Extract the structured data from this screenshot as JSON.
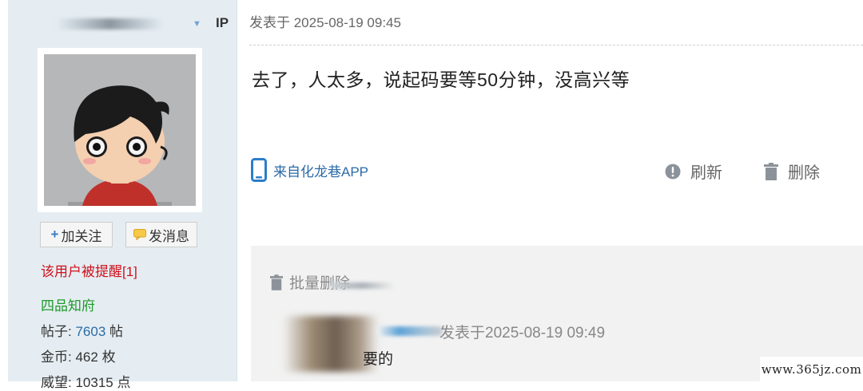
{
  "sidebar": {
    "ip_label": "IP",
    "follow_button": "加关注",
    "message_button": "发消息",
    "warning": "该用户被提醒[1]",
    "rank": "四品知府",
    "posts_label": "帖子:",
    "posts_value": "7603",
    "posts_unit": "帖",
    "coins_label": "金币:",
    "coins_value": "462",
    "coins_unit": "枚",
    "prestige_label": "威望:",
    "prestige_value": "10315",
    "prestige_unit": "点"
  },
  "post": {
    "time": "发表于 2025-08-19 09:45",
    "body": "去了，人太多，说起码要等50分钟，没高兴等",
    "source": "来自化龙巷APP",
    "refresh": "刷新",
    "delete": "删除"
  },
  "comments": {
    "batch_delete": "批量删除",
    "items": [
      {
        "time": "发表于2025-08-19 09:49",
        "text": "要的"
      }
    ]
  },
  "watermark": "www.365jz.com",
  "colors": {
    "sidebar_bg": "#e5edf2",
    "link_blue": "#2b6aa8",
    "warning_red": "#d0101b",
    "rank_green": "#1e9a2a"
  }
}
